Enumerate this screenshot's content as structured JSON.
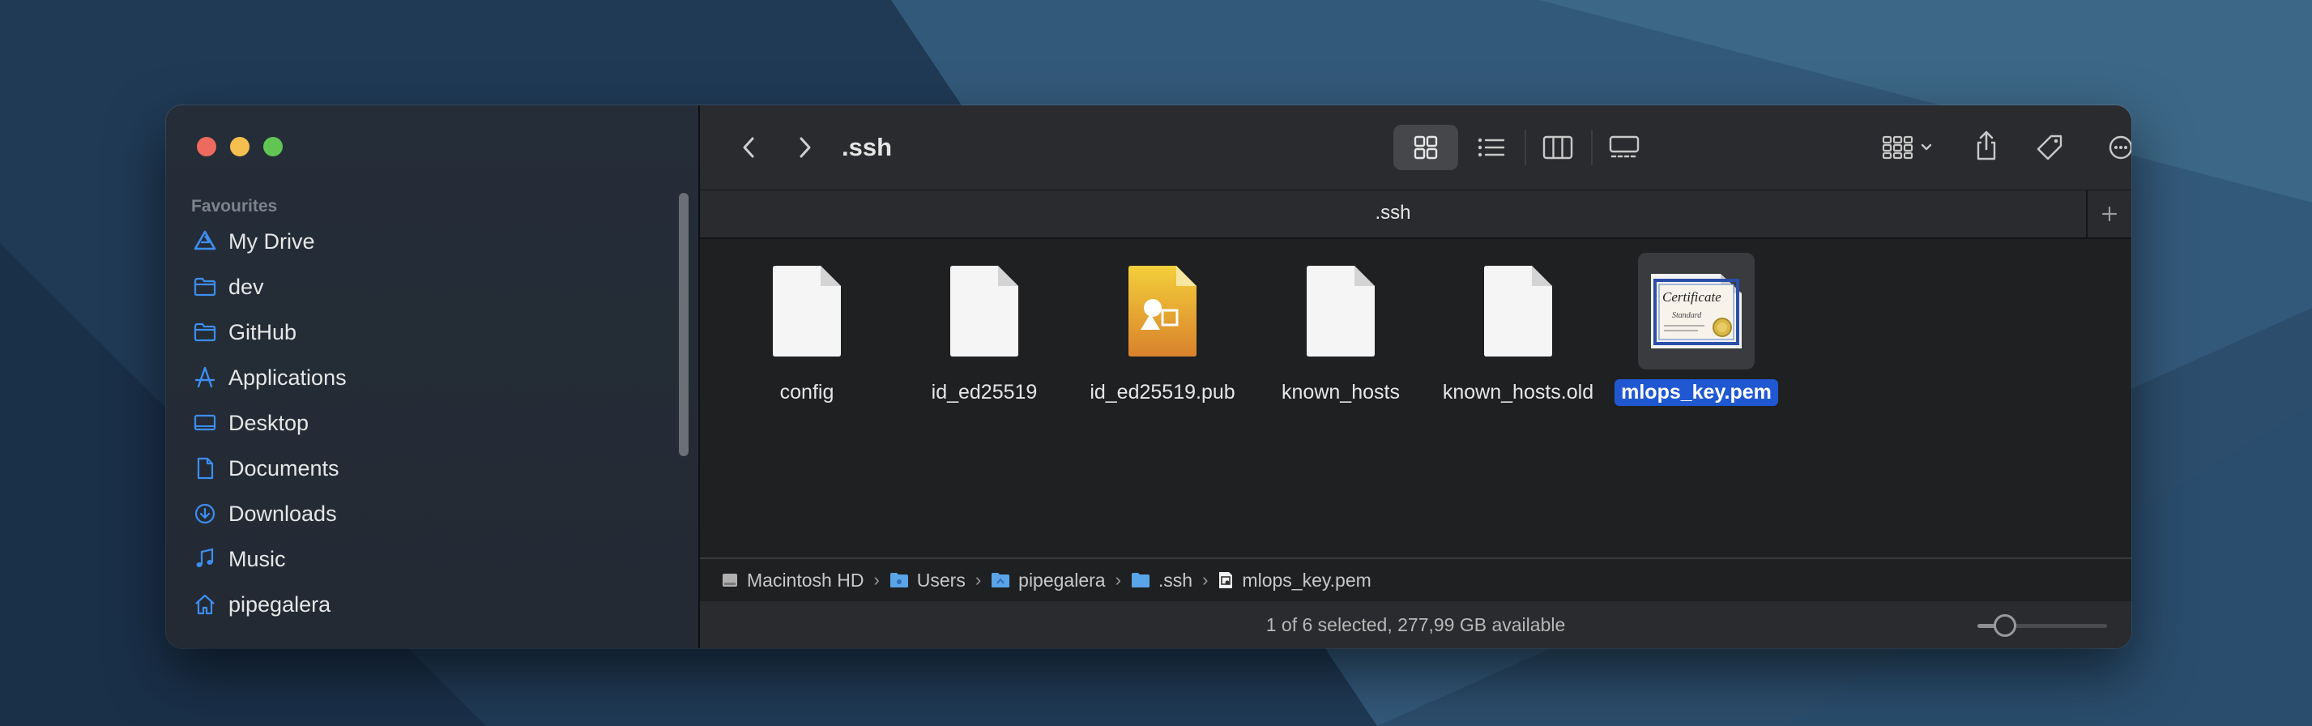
{
  "colors": {
    "accent": "#2058d2",
    "sidebar_icon": "#3d8ef0",
    "close": "#ed6a5e",
    "minimize": "#f5bf4f",
    "maximize": "#61c554"
  },
  "window": {
    "title": ".ssh",
    "tab_title": ".ssh",
    "view_mode": "icons"
  },
  "sidebar": {
    "section_title": "Favourites",
    "items": [
      {
        "label": "My Drive",
        "icon": "google-drive-icon"
      },
      {
        "label": "dev",
        "icon": "folder-icon"
      },
      {
        "label": "GitHub",
        "icon": "folder-icon"
      },
      {
        "label": "Applications",
        "icon": "applications-icon"
      },
      {
        "label": "Desktop",
        "icon": "desktop-icon"
      },
      {
        "label": "Documents",
        "icon": "document-icon"
      },
      {
        "label": "Downloads",
        "icon": "download-icon"
      },
      {
        "label": "Music",
        "icon": "music-note-icon"
      },
      {
        "label": "pipegalera",
        "icon": "home-icon"
      }
    ]
  },
  "toolbar": {
    "buttons": [
      "back-icon",
      "forward-icon",
      "icon-view-icon",
      "list-view-icon",
      "column-view-icon",
      "gallery-view-icon",
      "group-icon",
      "share-icon",
      "tag-icon",
      "more-icon",
      "search-icon"
    ]
  },
  "files": [
    {
      "name": "config",
      "type": "generic",
      "selected": false
    },
    {
      "name": "id_ed25519",
      "type": "generic",
      "selected": false
    },
    {
      "name": "id_ed25519.pub",
      "type": "keynote",
      "selected": false
    },
    {
      "name": "known_hosts",
      "type": "generic",
      "selected": false
    },
    {
      "name": "known_hosts.old",
      "type": "generic",
      "selected": false
    },
    {
      "name": "mlops_key.pem",
      "type": "certificate",
      "selected": true
    }
  ],
  "certificate_icon_text": {
    "line1": "Certificate",
    "line2": "Standard"
  },
  "path": [
    {
      "label": "Macintosh HD",
      "icon": "hard-drive-icon"
    },
    {
      "label": "Users",
      "icon": "folder-icon"
    },
    {
      "label": "pipegalera",
      "icon": "folder-icon"
    },
    {
      "label": ".ssh",
      "icon": "folder-icon"
    },
    {
      "label": "mlops_key.pem",
      "icon": "certificate-file-icon"
    }
  ],
  "path_separator": "›",
  "status": {
    "text": "1 of 6 selected, 277,99 GB available",
    "zoom_level": 0.15
  }
}
